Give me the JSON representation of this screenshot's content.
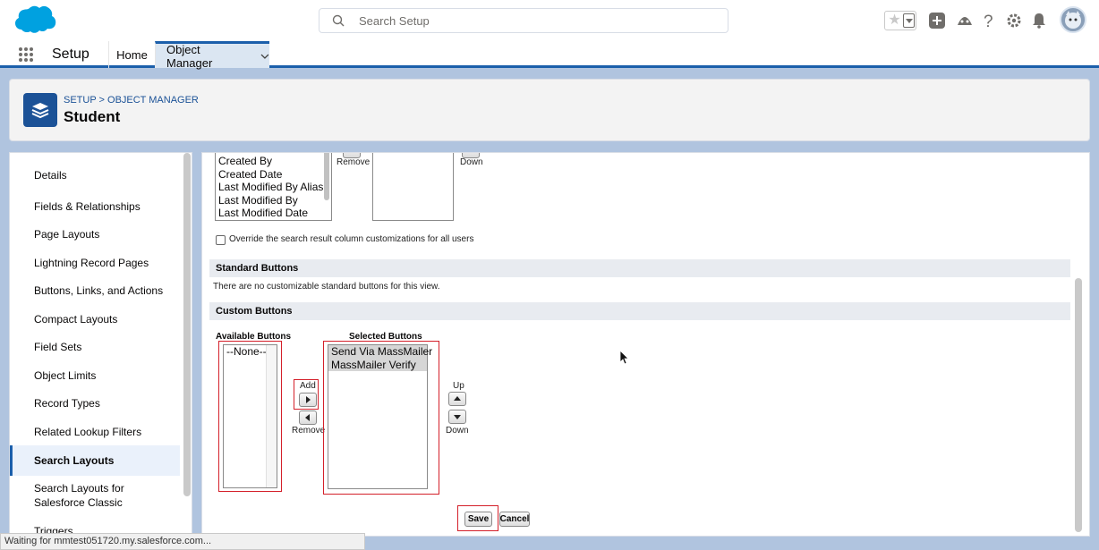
{
  "header": {
    "search_placeholder": "Search Setup",
    "icons": [
      "favorites-star-icon",
      "favorites-dropdown-icon",
      "add-icon",
      "trailhead-icon",
      "help-icon",
      "gear-icon",
      "notification-bell-icon",
      "avatar"
    ]
  },
  "context_bar": {
    "app_name": "Setup",
    "tabs": [
      {
        "label": "Home"
      },
      {
        "label": "Object Manager"
      }
    ]
  },
  "page_header": {
    "breadcrumb": "SETUP > OBJECT MANAGER",
    "title": "Student"
  },
  "sidebar": {
    "items": [
      {
        "label": "Details"
      },
      {
        "label": "Fields & Relationships"
      },
      {
        "label": "Page Layouts"
      },
      {
        "label": "Lightning Record Pages"
      },
      {
        "label": "Buttons, Links, and Actions"
      },
      {
        "label": "Compact Layouts"
      },
      {
        "label": "Field Sets"
      },
      {
        "label": "Object Limits"
      },
      {
        "label": "Record Types"
      },
      {
        "label": "Related Lookup Filters"
      },
      {
        "label": "Search Layouts"
      },
      {
        "label": "Search Layouts for Salesforce Classic"
      },
      {
        "label": "Triggers"
      }
    ],
    "active": "Search Layouts"
  },
  "columns_section": {
    "available_fields": [
      "Created By",
      "Created Date",
      "Last Modified By Alias",
      "Last Modified By",
      "Last Modified Date"
    ],
    "remove_label": "Remove",
    "down_label": "Down",
    "override_label": "Override the search result column customizations for all users"
  },
  "standard_buttons": {
    "title": "Standard Buttons",
    "message": "There are no customizable standard buttons for this view."
  },
  "custom_buttons": {
    "title": "Custom Buttons",
    "available_title": "Available Buttons",
    "available_options": [
      "--None--"
    ],
    "selected_title": "Selected Buttons",
    "selected_options": [
      "Send Via MassMailer",
      "MassMailer Verify"
    ],
    "add_label": "Add",
    "remove_label": "Remove",
    "up_label": "Up",
    "down_label": "Down"
  },
  "footer": {
    "save_label": "Save",
    "cancel_label": "Cancel"
  },
  "status_bar": {
    "text": "Waiting for mmtest051720.my.salesforce.com..."
  },
  "colors": {
    "brand_blue": "#1b5fab",
    "logo_blue": "#00a1e0",
    "highlight_red": "#d4202a"
  }
}
